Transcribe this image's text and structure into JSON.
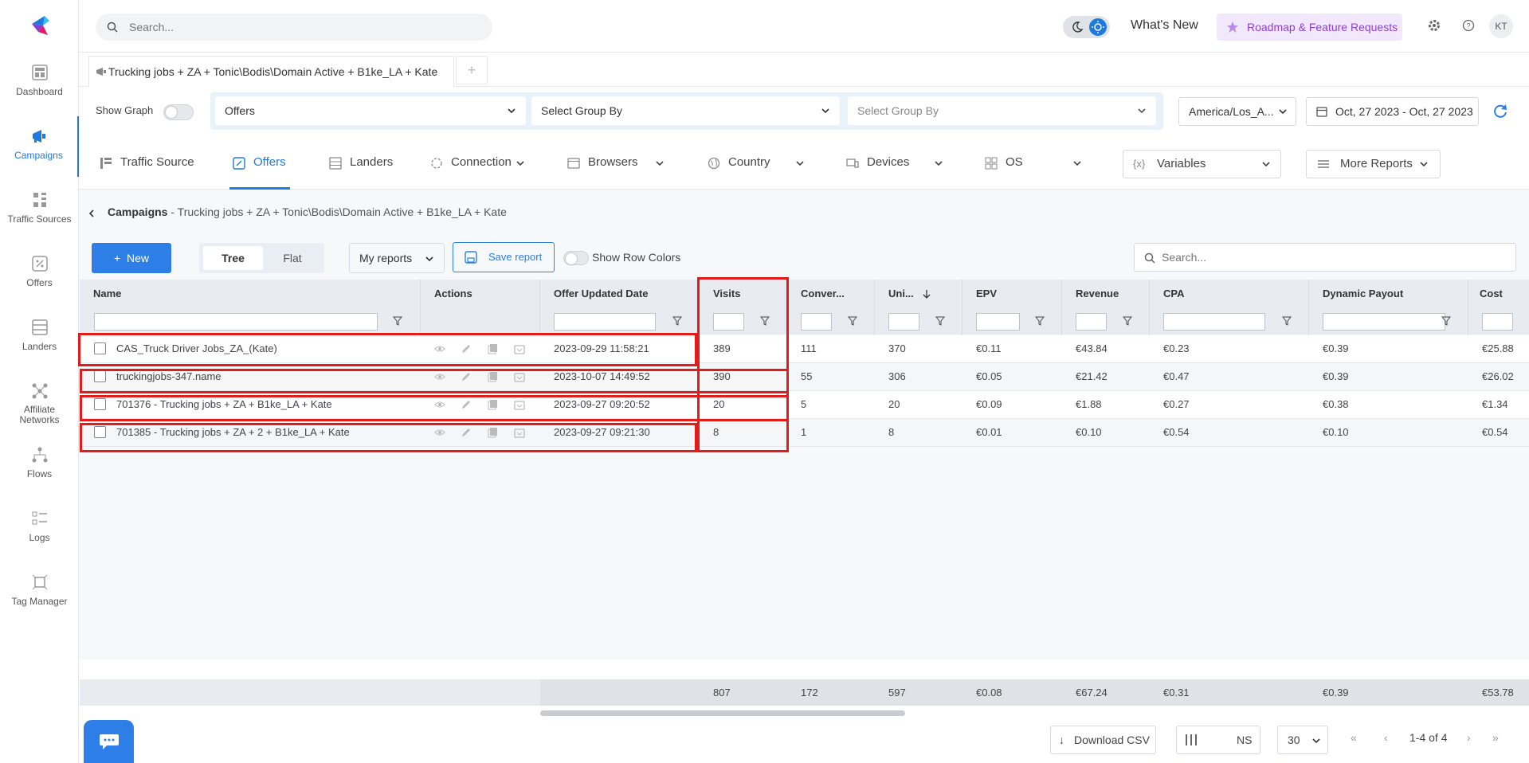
{
  "colors": {
    "accent": "#2d7ee6",
    "highlight": "#e41b1b",
    "roadmap": "#8b3fd1"
  },
  "sidebar": {
    "items": [
      {
        "label": "Dashboard",
        "icon": "dashboard-icon"
      },
      {
        "label": "Campaigns",
        "icon": "megaphone-icon",
        "active": true
      },
      {
        "label": "Traffic Sources",
        "icon": "traffic-icon"
      },
      {
        "label": "Offers",
        "icon": "offers-icon"
      },
      {
        "label": "Landers",
        "icon": "landers-icon"
      },
      {
        "label": "Affiliate Networks",
        "icon": "network-icon"
      },
      {
        "label": "Flows",
        "icon": "flows-icon"
      },
      {
        "label": "Logs",
        "icon": "logs-icon"
      },
      {
        "label": "Tag Manager",
        "icon": "tag-icon"
      }
    ]
  },
  "topbar": {
    "search_placeholder": "Search...",
    "whats_new": "What's New",
    "roadmap": "Roadmap & Feature Requests",
    "avatar": "KT"
  },
  "campaign_tab": {
    "title": "Trucking jobs + ZA + Tonic\\Bodis\\Domain Active + B1ke_LA + Kate",
    "add": "+"
  },
  "filters": {
    "show_graph": "Show Graph",
    "group1": "Offers",
    "group2": "Select Group By",
    "group3": "Select Group By",
    "timezone": "America/Los_A...",
    "date_range": "Oct, 27 2023 - Oct, 27 2023"
  },
  "report_tabs": {
    "traffic_source": "Traffic Source",
    "offers": "Offers",
    "landers": "Landers",
    "connection": "Connection",
    "browsers": "Browsers",
    "country": "Country",
    "devices": "Devices",
    "os": "OS",
    "variables": "Variables",
    "more_reports": "More Reports"
  },
  "breadcrumb": {
    "root": "Campaigns",
    "rest": " - Trucking jobs + ZA + Tonic\\Bodis\\Domain Active + B1ke_LA + Kate"
  },
  "toolbar": {
    "new": "New",
    "tree": "Tree",
    "flat": "Flat",
    "my_reports": "My reports",
    "save_report": "Save report",
    "show_row_colors": "Show Row Colors",
    "search_placeholder": "Search..."
  },
  "table": {
    "headers": {
      "name": "Name",
      "actions": "Actions",
      "updated": "Offer Updated Date",
      "visits": "Visits",
      "conversions": "Conver...",
      "unique": "Uni...",
      "epv": "EPV",
      "revenue": "Revenue",
      "cpa": "CPA",
      "payout": "Dynamic Payout",
      "cost": "Cost"
    },
    "rows": [
      {
        "name": "CAS_Truck Driver Jobs_ZA_(Kate)",
        "updated": "2023-09-29 11:58:21",
        "visits": "389",
        "conversions": "111",
        "unique": "370",
        "epv": "€0.11",
        "revenue": "€43.84",
        "cpa": "€0.23",
        "payout": "€0.39",
        "cost": "€25.88"
      },
      {
        "name": "truckingjobs-347.name",
        "updated": "2023-10-07 14:49:52",
        "visits": "390",
        "conversions": "55",
        "unique": "306",
        "epv": "€0.05",
        "revenue": "€21.42",
        "cpa": "€0.47",
        "payout": "€0.39",
        "cost": "€26.02"
      },
      {
        "name": "701376 - Trucking jobs + ZA + B1ke_LA + Kate",
        "updated": "2023-09-27 09:20:52",
        "visits": "20",
        "conversions": "5",
        "unique": "20",
        "epv": "€0.09",
        "revenue": "€1.88",
        "cpa": "€0.27",
        "payout": "€0.38",
        "cost": "€1.34"
      },
      {
        "name": "701385 - Trucking jobs + ZA + 2 + B1ke_LA + Kate",
        "updated": "2023-09-27 09:21:30",
        "visits": "8",
        "conversions": "1",
        "unique": "8",
        "epv": "€0.01",
        "revenue": "€0.10",
        "cpa": "€0.54",
        "payout": "€0.10",
        "cost": "€0.54"
      }
    ],
    "totals": {
      "visits": "807",
      "conversions": "172",
      "unique": "597",
      "epv": "€0.08",
      "revenue": "€67.24",
      "cpa": "€0.31",
      "payout": "€0.39",
      "cost": "€53.78"
    }
  },
  "footer": {
    "download_csv": "Download CSV",
    "ns": "NS",
    "page_size": "30",
    "page_info": "1-4 of 4"
  }
}
